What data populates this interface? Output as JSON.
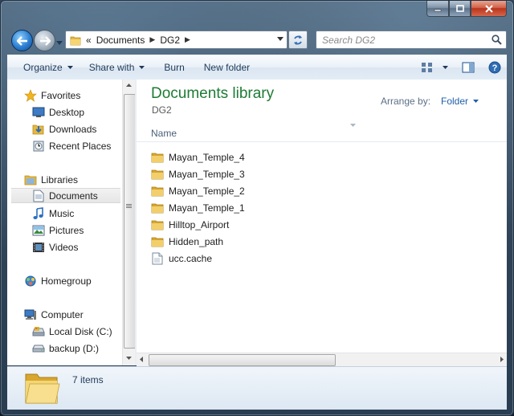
{
  "window": {
    "caption": {
      "minimize": "minimize",
      "maximize": "maximize",
      "close": "close"
    }
  },
  "address_bar": {
    "overflow": "«",
    "breadcrumbs": [
      "Documents",
      "DG2"
    ],
    "search_placeholder": "Search DG2"
  },
  "command_bar": {
    "organize": "Organize",
    "share_with": "Share with",
    "burn": "Burn",
    "new_folder": "New folder"
  },
  "nav_pane": {
    "favorites": {
      "label": "Favorites",
      "items": [
        "Desktop",
        "Downloads",
        "Recent Places"
      ]
    },
    "libraries": {
      "label": "Libraries",
      "items": [
        "Documents",
        "Music",
        "Pictures",
        "Videos"
      ],
      "selected": "Documents"
    },
    "homegroup": "Homegroup",
    "computer": {
      "label": "Computer",
      "items": [
        "Local Disk (C:)",
        "backup (D:)"
      ]
    }
  },
  "main": {
    "title": "Documents library",
    "subtitle": "DG2",
    "arrange_label": "Arrange by:",
    "arrange_value": "Folder",
    "column_name": "Name",
    "files": [
      {
        "name": "Mayan_Temple_4",
        "type": "folder"
      },
      {
        "name": "Mayan_Temple_3",
        "type": "folder"
      },
      {
        "name": "Mayan_Temple_2",
        "type": "folder"
      },
      {
        "name": "Mayan_Temple_1",
        "type": "folder"
      },
      {
        "name": "Hilltop_Airport",
        "type": "folder"
      },
      {
        "name": "Hidden_path",
        "type": "folder"
      },
      {
        "name": "ucc.cache",
        "type": "file"
      }
    ]
  },
  "details_pane": {
    "count": "7 items"
  },
  "colors": {
    "title_green": "#1e7b34",
    "link_blue": "#1f5fa8",
    "cmd_text": "#1e395b"
  }
}
